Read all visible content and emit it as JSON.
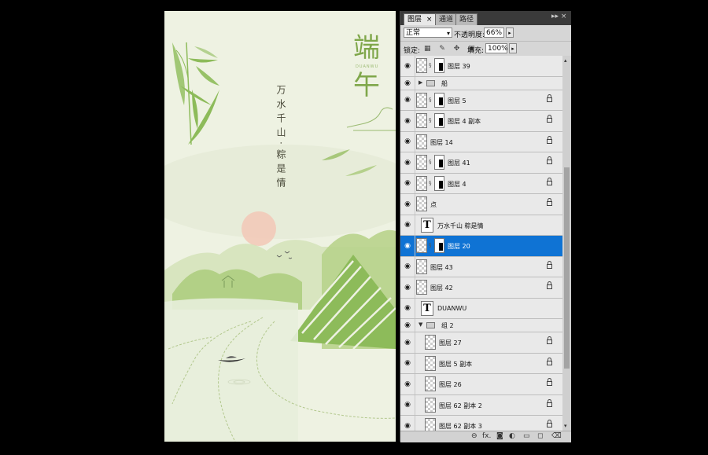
{
  "artwork": {
    "title_chars": [
      "端",
      "午"
    ],
    "pinyin": "DUANWU",
    "poem": "万水千山·粽是情",
    "colors": {
      "background": "#eef2e2",
      "green": "#8dbb5a",
      "sun": "#f2c8b6",
      "ink": "#4a4a3a"
    }
  },
  "panel": {
    "tabs": [
      {
        "label": "图层",
        "active": true
      },
      {
        "label": "通道",
        "active": false
      },
      {
        "label": "路径",
        "active": false
      }
    ],
    "tab_close": "×",
    "panel_controls": "▸▸ ×",
    "blend_mode": "正常",
    "opacity_label": "不透明度:",
    "opacity_value": "66%",
    "lock_label": "锁定:",
    "fill_label": "填充:",
    "fill_value": "100%",
    "layers": [
      {
        "name": "图层 39",
        "kind": "masked",
        "locked": false
      },
      {
        "name": "船",
        "kind": "group-collapsed",
        "locked": false
      },
      {
        "name": "图层 5",
        "kind": "masked",
        "locked": true
      },
      {
        "name": "图层 4 副本",
        "kind": "masked",
        "locked": true
      },
      {
        "name": "图层 14",
        "kind": "plain",
        "locked": true
      },
      {
        "name": "图层 41",
        "kind": "masked",
        "locked": true
      },
      {
        "name": "图层 4",
        "kind": "masked",
        "locked": true
      },
      {
        "name": "点",
        "kind": "plain",
        "locked": true
      },
      {
        "name": "万水千山 粽是情",
        "kind": "text",
        "locked": false
      },
      {
        "name": "图层 20",
        "kind": "masked-selected",
        "locked": false
      },
      {
        "name": "图层 43",
        "kind": "plain",
        "locked": true
      },
      {
        "name": "图层 42",
        "kind": "plain",
        "locked": true
      },
      {
        "name": "DUANWU",
        "kind": "text",
        "locked": false
      },
      {
        "name": "组 2",
        "kind": "group-open",
        "locked": false
      },
      {
        "name": "图层 27",
        "kind": "child",
        "locked": true
      },
      {
        "name": "图层 5 副本",
        "kind": "child",
        "locked": true
      },
      {
        "name": "图层 26",
        "kind": "child",
        "locked": true
      },
      {
        "name": "图层 62 副本 2",
        "kind": "child",
        "locked": true
      },
      {
        "name": "图层 62 副本 3",
        "kind": "child",
        "locked": true
      }
    ],
    "footer_icons": [
      "link-icon",
      "fx-icon",
      "mask-icon",
      "adjustment-icon",
      "folder-icon",
      "new-layer-icon",
      "trash-icon"
    ],
    "footer_glyphs": {
      "link": "⊖",
      "fx": "fx.",
      "mask": "◙",
      "adjust": "◐",
      "folder": "▭",
      "new": "◻",
      "trash": "⌫"
    },
    "text_thumb_glyph": "T",
    "eye_glyph": "◉"
  }
}
